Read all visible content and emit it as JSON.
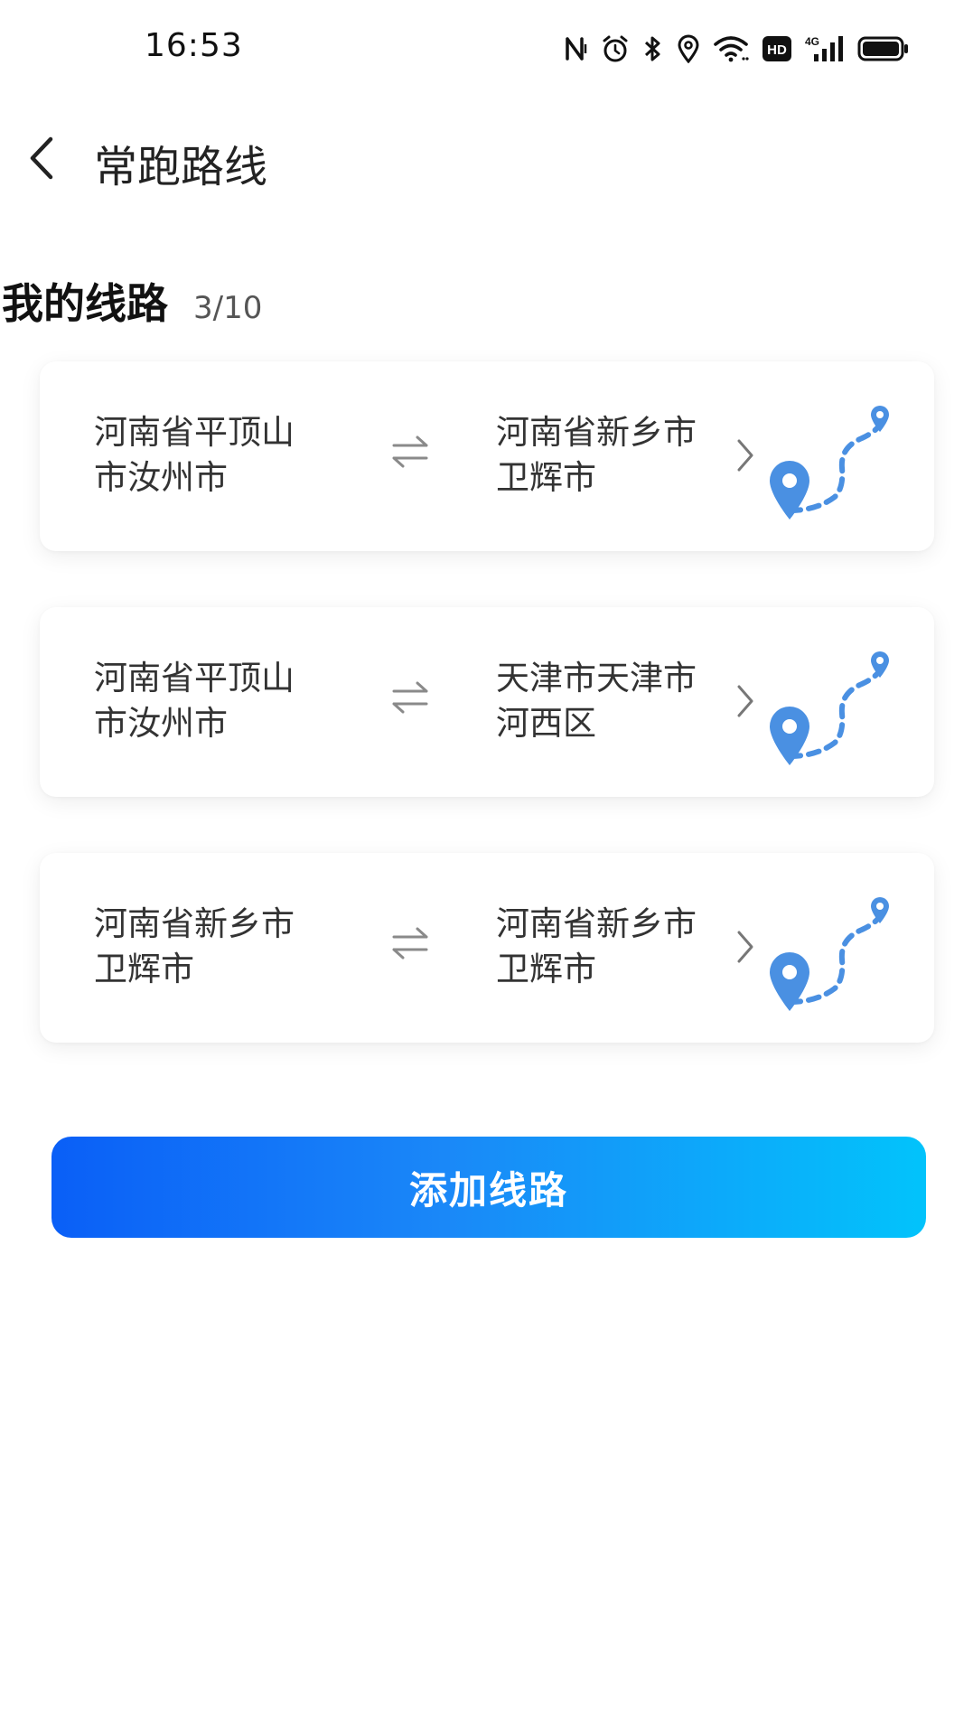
{
  "status_bar": {
    "time": "16:53",
    "icons": [
      "nfc-icon",
      "alarm-icon",
      "bluetooth-icon",
      "location-icon",
      "wifi-icon",
      "hd-icon",
      "signal-4g-icon",
      "battery-icon"
    ],
    "hd_label": "HD",
    "network_label": "4G"
  },
  "header": {
    "title": "常跑路线",
    "back_icon": "back-arrow-icon"
  },
  "section": {
    "title": "我的线路",
    "count": "3/10"
  },
  "routes": [
    {
      "from": "河南省平顶山市汝州市",
      "to": "河南省新乡市卫辉市"
    },
    {
      "from": "河南省平顶山市汝州市",
      "to": "天津市天津市河西区"
    },
    {
      "from": "河南省新乡市卫辉市",
      "to": "河南省新乡市卫辉市"
    }
  ],
  "add_button": {
    "label": "添加线路"
  },
  "colors": {
    "accent_start": "#0a5ff7",
    "accent_end": "#02c3fb",
    "map_pin": "#4a90e2"
  }
}
